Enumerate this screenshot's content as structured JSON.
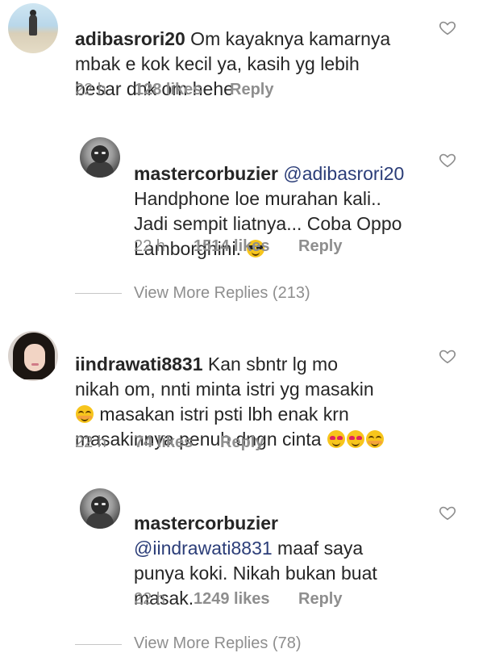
{
  "comments": [
    {
      "username": "adibasrori20",
      "text": " Om kayaknya kamarnya\nmbak e kok kecil ya, kasih yg lebih\nbesar dnk om hehe",
      "time": "22 h",
      "likes": "128 likes",
      "reply": "Reply"
    },
    {
      "username": "mastercorbuzier",
      "mention": "@adibasrori20",
      "text": "Handphone loe murahan kali..\nJadi sempit liatnya... Coba Oppo\nLamborghini. ",
      "time": "22 h",
      "likes": "1514 likes",
      "reply": "Reply"
    },
    {
      "view_more": "View More Replies (213)"
    },
    {
      "username": "iindrawati8831",
      "text": " Kan sbntr lg mo\nnikah om, nnti minta istri yg masakin",
      "text2": " masakan istri psti lbh enak krn\nmasakinnya penuh dngn cinta ",
      "time": "22 h",
      "likes": "74 likes",
      "reply": "Reply"
    },
    {
      "username": "mastercorbuzier",
      "mention": "@iindrawati8831",
      "text": " maaf saya\npunya koki. Nikah bukan buat\nmasak.",
      "time": "22 h",
      "likes": "1249 likes",
      "reply": "Reply"
    },
    {
      "view_more": "View More Replies (78)"
    }
  ],
  "icons": {
    "like": "heart-outline-icon",
    "emoji_sunglasses": "sunglasses-face-emoji",
    "emoji_smile": "smiling-face-emoji",
    "emoji_heart_eyes": "heart-eyes-emoji"
  },
  "colors": {
    "text": "#262626",
    "meta": "#8e8e8e",
    "mention": "#2b3d78"
  }
}
